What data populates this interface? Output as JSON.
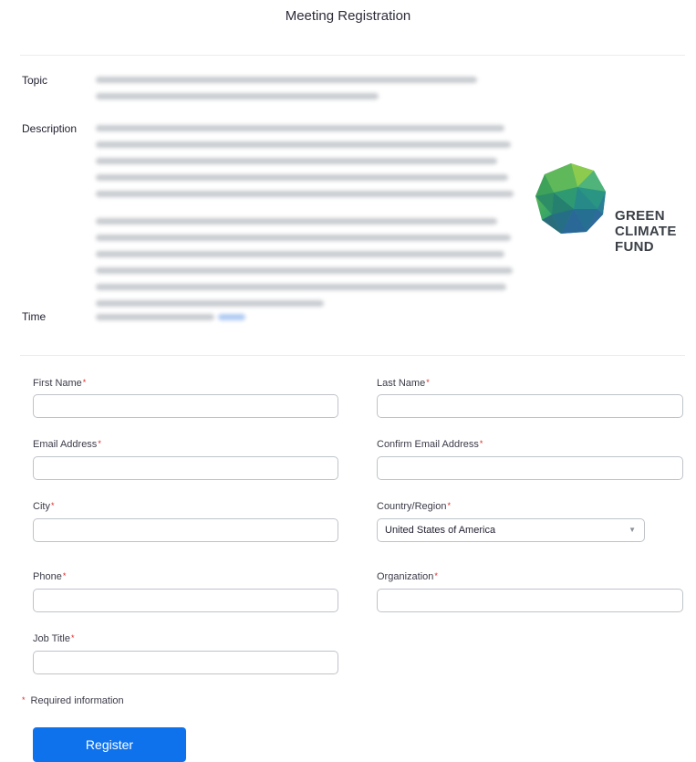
{
  "header": {
    "title": "Meeting Registration"
  },
  "info": {
    "topic_label": "Topic",
    "description_label": "Description",
    "time_label": "Time"
  },
  "logo": {
    "line1": "GREEN",
    "line2": "CLIMATE",
    "line3": "FUND",
    "icon": "green-climate-fund-globe-icon"
  },
  "form": {
    "first_name_label": "First Name",
    "last_name_label": "Last Name",
    "email_label": "Email Address",
    "confirm_email_label": "Confirm Email Address",
    "city_label": "City",
    "country_label": "Country/Region",
    "country_value": "United States of America",
    "phone_label": "Phone",
    "organization_label": "Organization",
    "job_title_label": "Job Title",
    "required_star": "*",
    "required_note": "Required information",
    "register_label": "Register"
  },
  "colors": {
    "accent": "#0e72ed",
    "required": "#e02828",
    "logo_text": "#3a3f46"
  }
}
